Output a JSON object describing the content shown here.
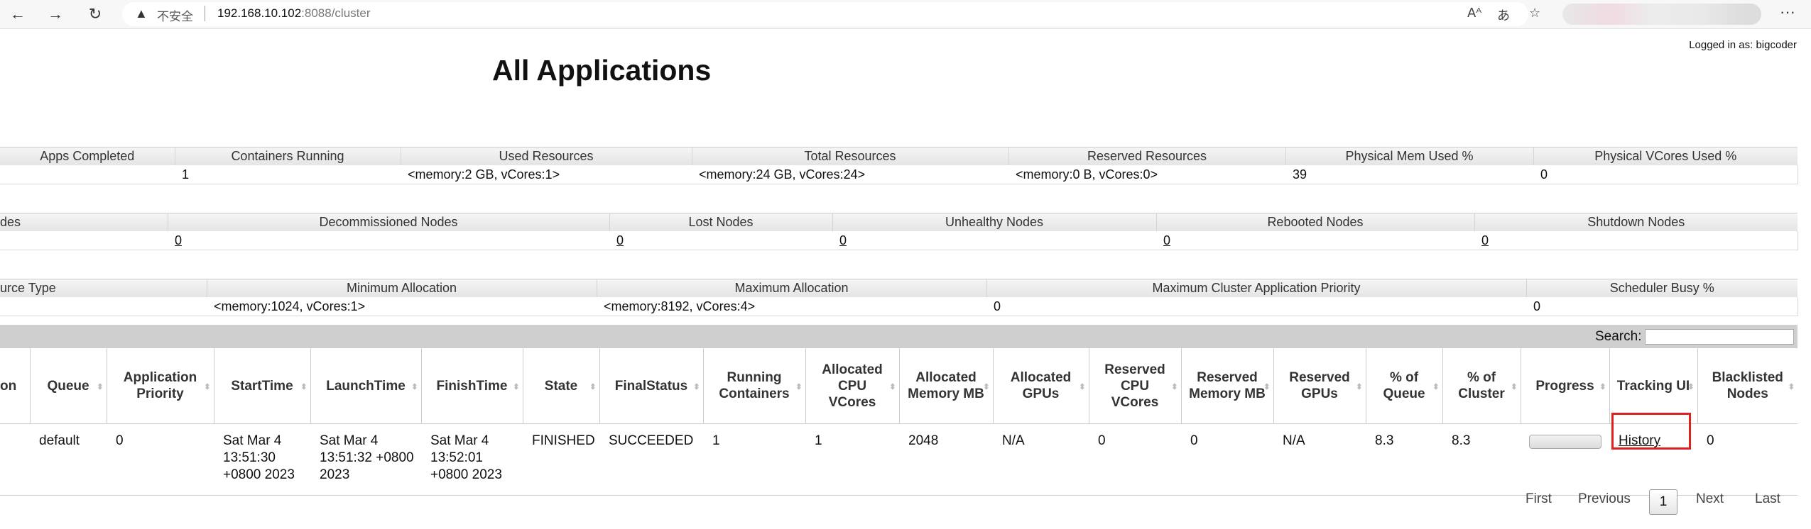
{
  "browser": {
    "security_text": "不安全",
    "url_host": "192.168.10.102",
    "url_rest": ":8088/cluster"
  },
  "page": {
    "logged_in": "Logged in as: bigcoder",
    "title": "All Applications"
  },
  "cluster_metrics": {
    "headers": [
      "Apps Completed",
      "Containers Running",
      "Used Resources",
      "Total Resources",
      "Reserved Resources",
      "Physical Mem Used %",
      "Physical VCores Used %"
    ],
    "values": [
      "",
      "1",
      "<memory:2 GB, vCores:1>",
      "<memory:24 GB, vCores:24>",
      "<memory:0 B, vCores:0>",
      "39",
      "0"
    ]
  },
  "node_metrics": {
    "headers": [
      "des",
      "Decommissioned Nodes",
      "Lost Nodes",
      "Unhealthy Nodes",
      "Rebooted Nodes",
      "Shutdown Nodes"
    ],
    "values": [
      "",
      "0",
      "0",
      "0",
      "0",
      "0"
    ]
  },
  "scheduler_metrics": {
    "headers": [
      "urce Type",
      "Minimum Allocation",
      "Maximum Allocation",
      "Maximum Cluster Application Priority",
      "Scheduler Busy %"
    ],
    "values": [
      "",
      "<memory:1024, vCores:1>",
      "<memory:8192, vCores:4>",
      "0",
      "0"
    ]
  },
  "search": {
    "label": "Search:",
    "value": ""
  },
  "apps_table": {
    "headers": [
      "on",
      "Queue",
      "Application Priority",
      "StartTime",
      "LaunchTime",
      "FinishTime",
      "State",
      "FinalStatus",
      "Running Containers",
      "Allocated CPU VCores",
      "Allocated Memory MB",
      "Allocated GPUs",
      "Reserved CPU VCores",
      "Reserved Memory MB",
      "Reserved GPUs",
      "% of Queue",
      "% of Cluster",
      "Progress",
      "Tracking UI",
      "Blacklisted Nodes"
    ],
    "row": {
      "id_tail": "",
      "queue": "default",
      "priority": "0",
      "start_time": "Sat Mar 4 13:51:30 +0800 2023",
      "launch_time": "Sat Mar 4 13:51:32 +0800 2023",
      "finish_time": "Sat Mar 4 13:52:01 +0800 2023",
      "state": "FINISHED",
      "final_status": "SUCCEEDED",
      "running_containers": "1",
      "alloc_vcores": "1",
      "alloc_memory": "2048",
      "alloc_gpus": "N/A",
      "res_vcores": "0",
      "res_memory": "0",
      "res_gpus": "N/A",
      "pct_queue": "8.3",
      "pct_cluster": "8.3",
      "tracking_ui": "History",
      "blacklisted": "0"
    }
  },
  "pagination": {
    "first": "First",
    "previous": "Previous",
    "current": "1",
    "next": "Next",
    "last": "Last"
  }
}
